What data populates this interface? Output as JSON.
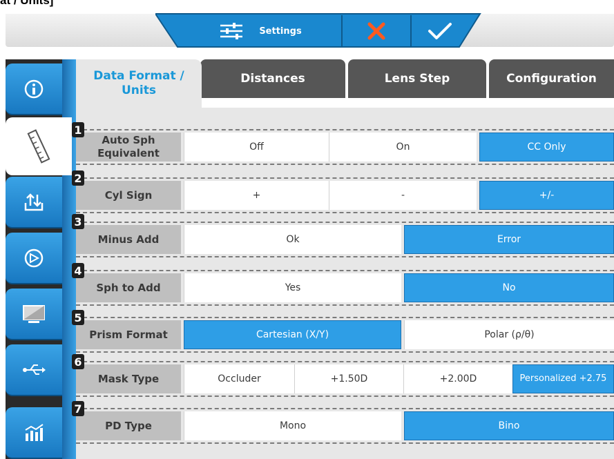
{
  "page_heading": "at / Units]",
  "header": {
    "settings_label": "Settings"
  },
  "tabs": [
    {
      "label": "Data Format / Units"
    },
    {
      "label": "Distances"
    },
    {
      "label": "Lens Step"
    },
    {
      "label": "Configuration"
    }
  ],
  "sidebar": {
    "items": [
      {
        "icon": "info-icon"
      },
      {
        "icon": "ruler-icon"
      },
      {
        "icon": "upload-download-icon"
      },
      {
        "icon": "compass-icon"
      },
      {
        "icon": "monitor-icon"
      },
      {
        "icon": "usb-icon"
      },
      {
        "icon": "chart-icon"
      }
    ]
  },
  "rows": [
    {
      "num": "1",
      "label": "Auto Sph Equivalent",
      "options": [
        "Off",
        "On",
        "CC Only"
      ],
      "selected": "CC Only"
    },
    {
      "num": "2",
      "label": "Cyl Sign",
      "options": [
        "+",
        "-",
        "+/-"
      ],
      "selected": "+/-"
    },
    {
      "num": "3",
      "label": "Minus Add",
      "options": [
        "Ok",
        "Error"
      ],
      "selected": "Error"
    },
    {
      "num": "4",
      "label": "Sph to Add",
      "options": [
        "Yes",
        "No"
      ],
      "selected": "No"
    },
    {
      "num": "5",
      "label": "Prism Format",
      "options": [
        "Cartesian (X/Y)",
        "Polar (ρ/θ)"
      ],
      "selected": "Cartesian (X/Y)"
    },
    {
      "num": "6",
      "label": "Mask Type",
      "options": [
        "Occluder",
        "+1.50D",
        "+2.00D",
        "Personalized +2.75"
      ],
      "selected": "Personalized +2.75"
    },
    {
      "num": "7",
      "label": "PD Type",
      "options": [
        "Mono",
        "Bino"
      ],
      "selected": "Bino"
    }
  ],
  "colors": {
    "accent": "#2e9ee6",
    "cancel": "#ff5a1f"
  }
}
